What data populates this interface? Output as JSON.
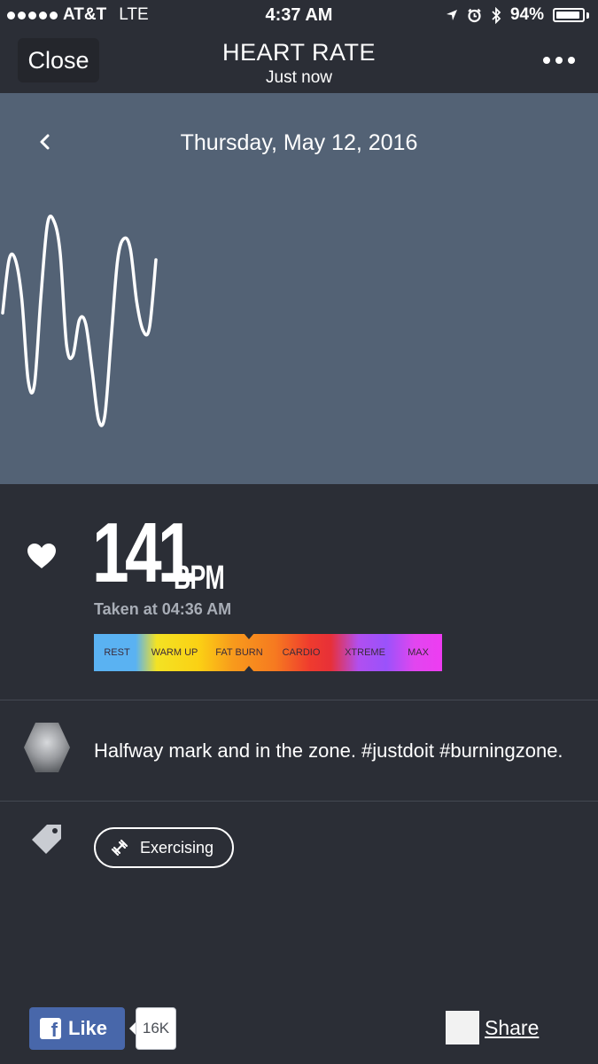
{
  "status_bar": {
    "carrier": "AT&T",
    "network": "LTE",
    "time": "4:37 AM",
    "battery_text": "94%",
    "battery_level": 0.94,
    "icons": [
      "location-arrow-icon",
      "alarm-icon",
      "bluetooth-icon",
      "battery-icon"
    ]
  },
  "header": {
    "close_label": "Close",
    "title": "HEART RATE",
    "subtitle": "Just now",
    "more_icon": "ellipsis-icon"
  },
  "chart": {
    "date_label": "Thursday, May 12, 2016",
    "line_color": "#ffffff",
    "background": "#536275"
  },
  "chart_data": {
    "type": "line",
    "title": "",
    "xlabel": "",
    "ylabel": "",
    "series": [
      {
        "values": [
          138,
          153,
          153,
          142,
          119,
          118,
          143,
          163,
          164,
          155,
          129,
          126,
          136,
          135,
          122,
          108,
          109,
          131,
          153,
          159,
          156,
          141,
          133,
          134,
          153
        ]
      }
    ],
    "ylim": [
      90,
      190
    ],
    "grid": false
  },
  "reading": {
    "value": "141",
    "unit": "BPM",
    "taken_at": "Taken at 04:36 AM",
    "zones": [
      "REST",
      "WARM UP",
      "FAT BURN",
      "CARDIO",
      "XTREME",
      "MAX"
    ],
    "current_zone": "FAT BURN"
  },
  "comment": {
    "text": "Halfway mark and in the zone. #justdoit #burningzone."
  },
  "tag": {
    "label": "Exercising",
    "icon": "dumbbell-icon"
  },
  "footer": {
    "like_label": "Like",
    "like_count": "16K",
    "share_label": "Share"
  },
  "colors": {
    "background": "#2b2e36",
    "facebook_blue": "#4867aa"
  }
}
